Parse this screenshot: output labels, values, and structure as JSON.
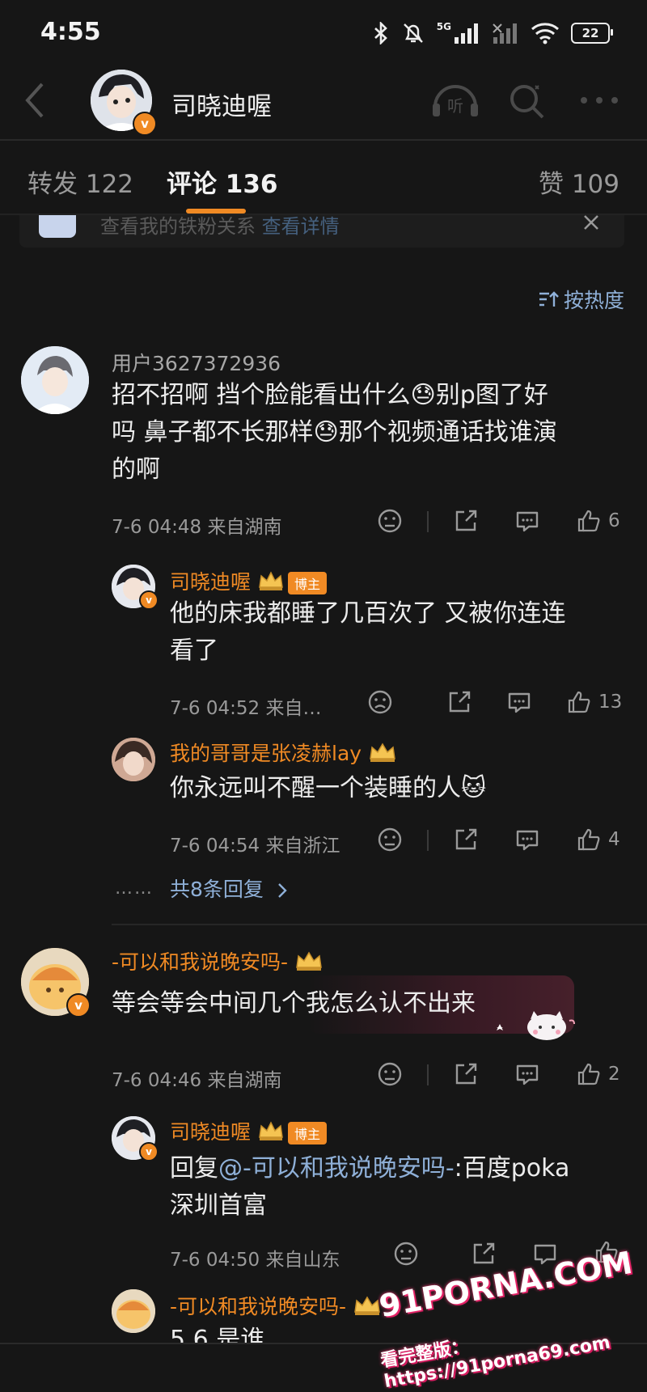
{
  "status_bar": {
    "time": "4:55",
    "network": "5G",
    "battery": "22"
  },
  "header": {
    "title": "司晓迪喔",
    "listen_label": "听"
  },
  "tabs": [
    {
      "label": "转发",
      "count": "122"
    },
    {
      "label": "评论",
      "count": "136"
    },
    {
      "label": "赞",
      "count": "109"
    }
  ],
  "banner": {
    "text": "查看我的铁粉关系",
    "link": "查看详情"
  },
  "sort": {
    "label": "按热度"
  },
  "comments": [
    {
      "user": "用户3627372936",
      "text_lines": [
        "招不招啊 挡个脸能看出什么😓别p图了好",
        "吗 鼻子都不长那样😓那个视频通话找谁演",
        "的啊"
      ],
      "time": "7-6 04:48",
      "location": "来自湖南",
      "likes": "6",
      "replies": [
        {
          "user": "司晓迪喔",
          "tag": "博主",
          "text_lines": [
            "他的床我都睡了几百次了 又被你连连",
            "看了"
          ],
          "time": "7-6 04:52",
          "location": "来自…",
          "likes": "13"
        },
        {
          "user": "我的哥哥是张凌赫lay",
          "text_lines": [
            "你永远叫不醒一个装睡的人🐱"
          ],
          "time": "7-6 04:54",
          "location": "来自浙江",
          "likes": "4"
        }
      ],
      "more_replies": "共8条回复",
      "more_dots": "……"
    },
    {
      "user": "-可以和我说晚安吗-",
      "text_lines": [
        "等会等会中间几个我怎么认不出来"
      ],
      "time": "7-6 04:46",
      "location": "来自湖南",
      "likes": "2",
      "replies": [
        {
          "user": "司晓迪喔",
          "tag": "博主",
          "reply_prefix": "回复",
          "mention": "@-可以和我说晚安吗-",
          "text_rest": ":百度poka",
          "text_line2": "深圳首富",
          "time": "7-6 04:50",
          "location": "来自山东"
        },
        {
          "user": "-可以和我说晚安吗-",
          "text_partial": "5 6 是谁"
        }
      ]
    }
  ],
  "watermark": {
    "main": "91PORNA.COM",
    "sub": "看完整版：https://91porna69.com"
  },
  "colors": {
    "accent": "#f08a24",
    "link": "#8fb0d8",
    "background": "#161616"
  }
}
